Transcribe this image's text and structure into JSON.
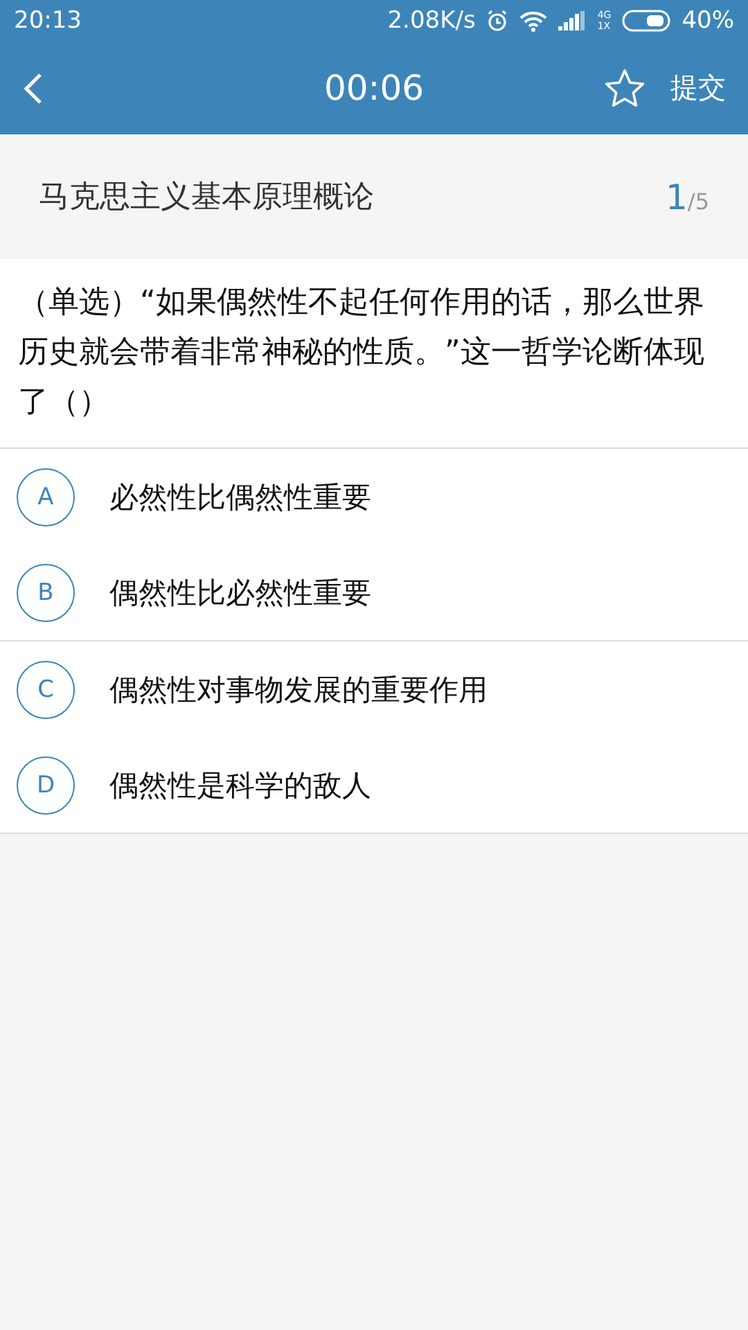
{
  "status_bar": {
    "time": "20:13",
    "speed": "2.08K/s",
    "network_type": "4G",
    "network_sub": "1X",
    "battery": "40%"
  },
  "header": {
    "timer": "00:06",
    "favorited": false,
    "submit": "提交"
  },
  "subject": {
    "title": "马克思主义基本原理概论",
    "current": "1",
    "total": "/5"
  },
  "question": {
    "text": "（单选）“如果偶然性不起任何作用的话，那么世界历史就会带着非常神秘的性质。”这一哲学论断体现了（）"
  },
  "options": [
    {
      "letter": "A",
      "text": "必然性比偶然性重要",
      "selected": false
    },
    {
      "letter": "B",
      "text": "偶然性比必然性重要",
      "selected": false
    },
    {
      "letter": "C",
      "text": "偶然性对事物发展的重要作用",
      "selected": false
    },
    {
      "letter": "D",
      "text": "偶然性是科学的敌人",
      "selected": false
    }
  ]
}
